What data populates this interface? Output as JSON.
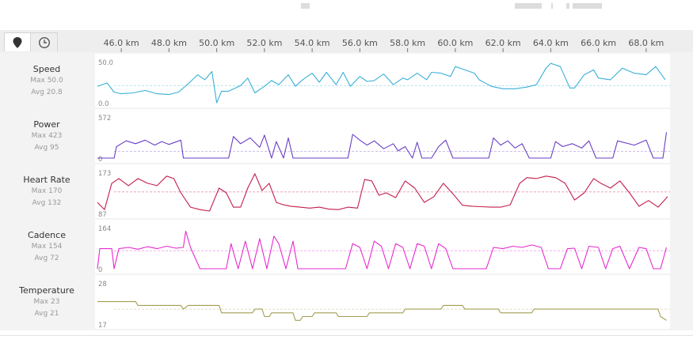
{
  "tabs": [
    {
      "icon": "map-pin-icon",
      "active": true
    },
    {
      "icon": "clock-icon",
      "active": false
    }
  ],
  "axis": {
    "unit": "km",
    "ticks": [
      "46.0 km",
      "48.0 km",
      "50.0 km",
      "52.0 km",
      "54.0 km",
      "56.0 km",
      "58.0 km",
      "60.0 km",
      "62.0 km",
      "64.0 km",
      "66.0 km",
      "68.0 km"
    ],
    "tick_values": [
      46,
      48,
      50,
      52,
      54,
      56,
      58,
      60,
      62,
      64,
      66,
      68
    ],
    "xlim": [
      44.9,
      69.0
    ]
  },
  "chart_data": [
    {
      "type": "line",
      "title": "Speed",
      "color": "#38b0d8",
      "max_label": "Max 50.0",
      "avg_label": "Avg 20.8",
      "ymax_label": "50.0",
      "ymin_label": "0.0",
      "ylim": [
        0,
        50
      ],
      "avg": 20.8,
      "x": [
        45.0,
        45.4,
        45.7,
        46.0,
        46.5,
        47.0,
        47.5,
        48.0,
        48.4,
        48.8,
        49.2,
        49.5,
        49.8,
        50.0,
        50.2,
        50.5,
        51.0,
        51.3,
        51.6,
        52.0,
        52.3,
        52.6,
        53.0,
        53.3,
        53.6,
        54.0,
        54.3,
        54.6,
        55.0,
        55.3,
        55.6,
        56.0,
        56.3,
        56.6,
        57.0,
        57.4,
        57.8,
        58.0,
        58.4,
        58.8,
        59.0,
        59.4,
        59.8,
        60.0,
        60.4,
        60.8,
        61.0,
        61.5,
        62.0,
        62.5,
        63.0,
        63.4,
        63.8,
        64.0,
        64.4,
        64.8,
        65.0,
        65.4,
        65.8,
        66.0,
        66.5,
        67.0,
        67.5,
        68.0,
        68.4,
        68.8
      ],
      "y": [
        20,
        24,
        13,
        11,
        12,
        15,
        11,
        10,
        13,
        23,
        34,
        28,
        38,
        0,
        14,
        14,
        21,
        30,
        12,
        20,
        27,
        22,
        34,
        20,
        28,
        36,
        25,
        37,
        22,
        37,
        20,
        32,
        26,
        27,
        35,
        22,
        30,
        28,
        36,
        28,
        37,
        36,
        32,
        44,
        40,
        36,
        28,
        20,
        17,
        17,
        19,
        22,
        42,
        48,
        44,
        18,
        18,
        34,
        40,
        30,
        28,
        42,
        36,
        34,
        44,
        28
      ]
    },
    {
      "type": "line",
      "title": "Power",
      "color": "#6a3fc4",
      "max_label": "Max 423",
      "avg_label": "Avg 95",
      "ymax_label": "572",
      "ymin_label": "0",
      "ylim": [
        0,
        572
      ],
      "avg": 95,
      "x": [
        45.0,
        45.7,
        45.8,
        46.2,
        46.6,
        47.0,
        47.4,
        47.7,
        48.0,
        48.5,
        48.6,
        49.0,
        50.0,
        50.5,
        50.7,
        51.0,
        51.4,
        51.8,
        52.0,
        52.3,
        52.5,
        52.8,
        53.0,
        53.2,
        53.5,
        55.0,
        55.5,
        55.7,
        56.0,
        56.3,
        56.6,
        57.0,
        57.4,
        57.6,
        57.9,
        58.2,
        58.4,
        58.6,
        59.0,
        59.3,
        59.6,
        59.9,
        61.4,
        61.6,
        61.9,
        62.2,
        62.5,
        62.8,
        63.1,
        64.0,
        64.2,
        64.5,
        64.9,
        65.3,
        65.6,
        65.9,
        66.3,
        66.6,
        66.8,
        67.5,
        68.0,
        68.3,
        68.5,
        68.7,
        68.85
      ],
      "y": [
        0,
        0,
        160,
        240,
        200,
        250,
        180,
        230,
        190,
        250,
        0,
        0,
        0,
        0,
        300,
        200,
        280,
        150,
        320,
        0,
        230,
        0,
        280,
        0,
        0,
        0,
        0,
        330,
        250,
        180,
        240,
        130,
        200,
        100,
        160,
        0,
        220,
        0,
        0,
        160,
        250,
        0,
        0,
        280,
        180,
        240,
        140,
        200,
        0,
        0,
        230,
        160,
        200,
        140,
        240,
        0,
        0,
        0,
        240,
        180,
        250,
        0,
        0,
        0,
        360
      ]
    },
    {
      "type": "line",
      "title": "Heart Rate",
      "color": "#c41d4c",
      "max_label": "Max 170",
      "avg_label": "Avg 132",
      "ymax_label": "173",
      "ymin_label": "87",
      "ylim": [
        87,
        173
      ],
      "avg": 132,
      "x": [
        45.0,
        45.3,
        45.6,
        45.9,
        46.3,
        46.7,
        47.1,
        47.5,
        47.9,
        48.2,
        48.5,
        48.9,
        49.3,
        49.7,
        50.1,
        50.4,
        50.7,
        51.0,
        51.3,
        51.6,
        51.9,
        52.2,
        52.5,
        52.8,
        53.1,
        53.5,
        53.9,
        54.3,
        54.7,
        55.1,
        55.5,
        55.9,
        56.2,
        56.5,
        56.8,
        57.1,
        57.5,
        57.9,
        58.3,
        58.7,
        59.1,
        59.5,
        59.9,
        60.3,
        60.7,
        61.1,
        61.5,
        61.9,
        62.3,
        62.7,
        63.0,
        63.4,
        63.8,
        64.2,
        64.6,
        65.0,
        65.4,
        65.8,
        66.1,
        66.5,
        66.9,
        67.3,
        67.7,
        68.1,
        68.5,
        68.9
      ],
      "y": [
        110,
        95,
        150,
        160,
        145,
        160,
        150,
        145,
        165,
        160,
        130,
        100,
        95,
        92,
        140,
        130,
        100,
        100,
        140,
        170,
        135,
        150,
        110,
        105,
        102,
        100,
        98,
        100,
        96,
        95,
        100,
        98,
        158,
        155,
        125,
        130,
        120,
        155,
        140,
        110,
        122,
        150,
        128,
        104,
        102,
        101,
        100,
        100,
        105,
        150,
        162,
        160,
        165,
        162,
        150,
        115,
        130,
        160,
        150,
        140,
        155,
        130,
        102,
        114,
        100,
        122
      ]
    },
    {
      "type": "line",
      "title": "Cadence",
      "color": "#e62ad0",
      "max_label": "Max 154",
      "avg_label": "Avg 72",
      "ymax_label": "164",
      "ymin_label": "0",
      "ylim": [
        0,
        164
      ],
      "avg": 72,
      "x": [
        45.0,
        45.1,
        45.6,
        45.7,
        45.9,
        46.3,
        46.7,
        47.1,
        47.5,
        47.9,
        48.3,
        48.6,
        48.7,
        48.9,
        49.3,
        50.0,
        50.4,
        50.6,
        50.9,
        51.2,
        51.5,
        51.8,
        52.1,
        52.4,
        52.6,
        52.9,
        53.2,
        53.4,
        55.0,
        55.4,
        55.7,
        56.0,
        56.3,
        56.6,
        56.9,
        57.2,
        57.5,
        57.8,
        58.1,
        58.4,
        58.7,
        59.0,
        59.3,
        59.6,
        59.9,
        61.3,
        61.6,
        62.0,
        62.4,
        62.8,
        63.2,
        63.6,
        63.9,
        64.4,
        64.7,
        65.0,
        65.3,
        65.6,
        66.0,
        66.3,
        66.6,
        66.9,
        67.3,
        67.7,
        68.0,
        68.3,
        68.6,
        68.85
      ],
      "y": [
        0,
        80,
        80,
        0,
        80,
        85,
        78,
        88,
        80,
        90,
        82,
        85,
        150,
        85,
        0,
        0,
        0,
        100,
        0,
        110,
        0,
        120,
        0,
        130,
        100,
        0,
        110,
        0,
        0,
        0,
        100,
        85,
        0,
        110,
        90,
        0,
        100,
        85,
        0,
        100,
        90,
        0,
        100,
        80,
        0,
        0,
        85,
        80,
        90,
        85,
        95,
        85,
        0,
        0,
        80,
        82,
        0,
        90,
        85,
        0,
        80,
        90,
        0,
        85,
        80,
        0,
        0,
        85
      ]
    },
    {
      "type": "line",
      "title": "Temperature",
      "color": "#a39e52",
      "max_label": "Max 23",
      "avg_label": "Avg 21",
      "ymax_label": "28",
      "ymin_label": "17",
      "ylim": [
        17,
        28
      ],
      "avg": 21,
      "x": [
        45.0,
        46.6,
        46.7,
        48.5,
        48.6,
        48.8,
        50.1,
        50.2,
        51.5,
        51.6,
        51.9,
        52.0,
        52.2,
        52.3,
        53.2,
        53.3,
        53.5,
        53.6,
        54.0,
        54.1,
        55.0,
        55.1,
        56.3,
        56.4,
        57.8,
        57.9,
        59.4,
        59.5,
        60.3,
        60.4,
        61.8,
        61.9,
        63.2,
        63.3,
        68.5,
        68.6,
        68.85
      ],
      "y": [
        23,
        23,
        22,
        22,
        21,
        22,
        22,
        20,
        20,
        21,
        21,
        19,
        19,
        20,
        20,
        18,
        18,
        19,
        19,
        20,
        20,
        19,
        19,
        20,
        20,
        21,
        21,
        22,
        22,
        21,
        21,
        20,
        20,
        21,
        21,
        19,
        18
      ]
    }
  ]
}
